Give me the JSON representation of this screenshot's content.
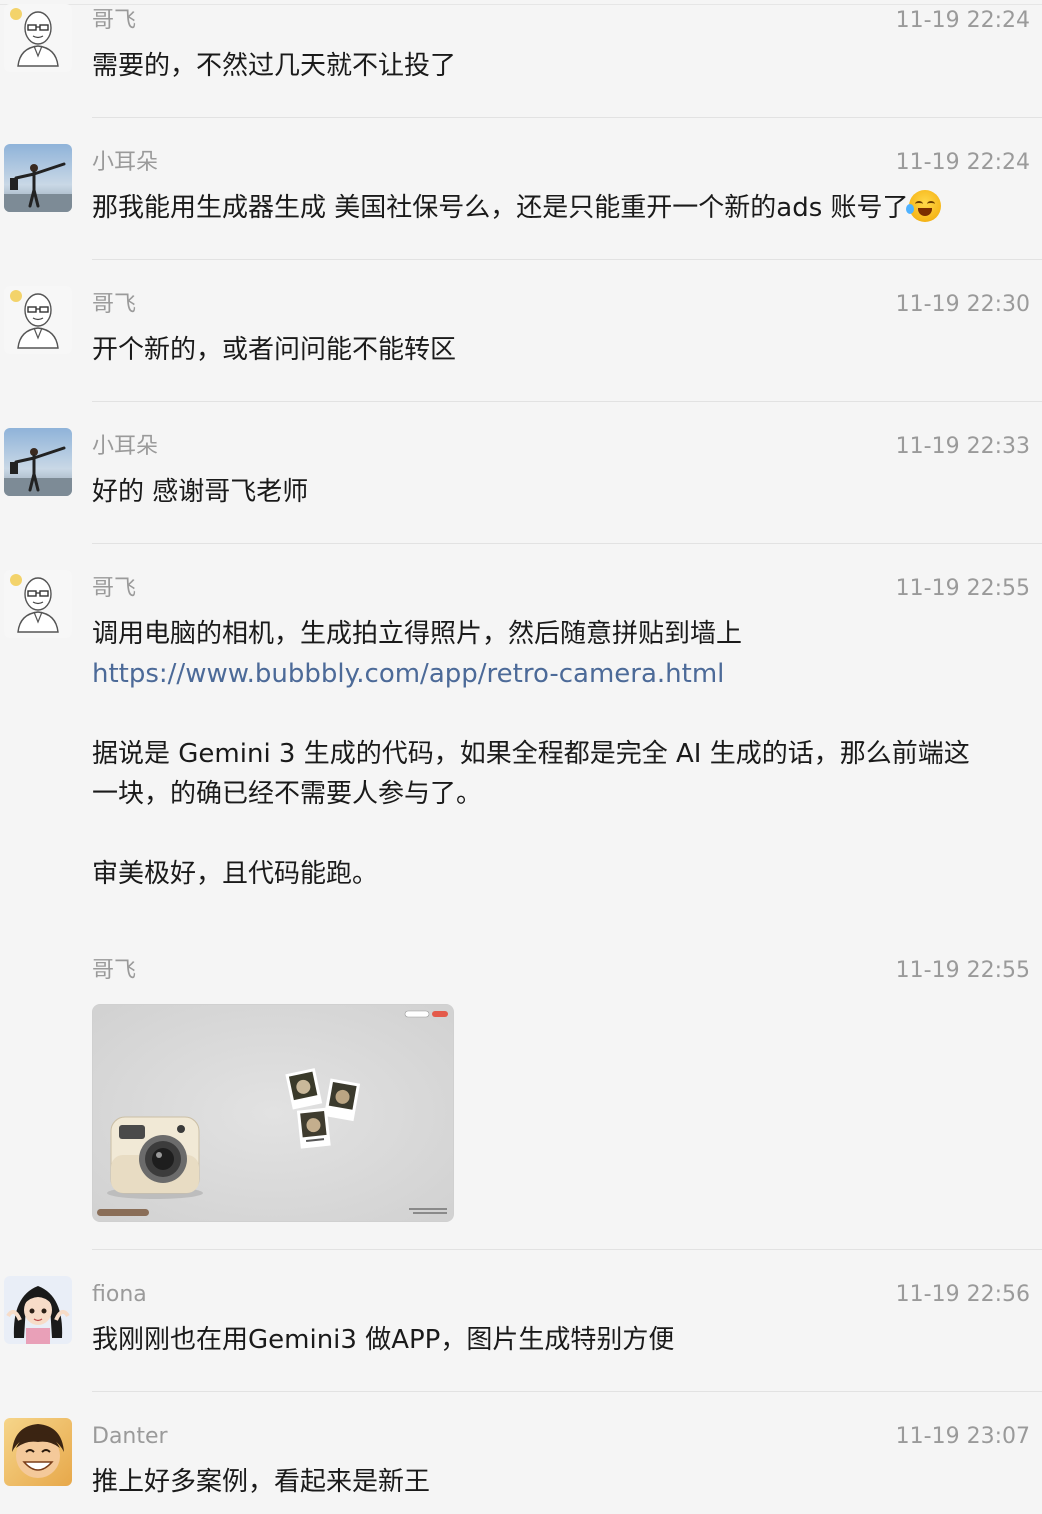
{
  "messages": [
    {
      "sender": "哥飞",
      "time": "11-19 22:24",
      "avatar": "bald-man-avatar",
      "lines": [
        "需要的，不然过几天就不让投了"
      ]
    },
    {
      "sender": "小耳朵",
      "time": "11-19 22:24",
      "avatar": "beach-person-avatar",
      "lines": [
        "那我能用生成器生成 美国社保号么，还是只能重开一个新的ads 账号了"
      ],
      "emoji": "rolling-laughing-emoji"
    },
    {
      "sender": "哥飞",
      "time": "11-19 22:30",
      "avatar": "bald-man-avatar",
      "lines": [
        "开个新的，或者问问能不能转区"
      ]
    },
    {
      "sender": "小耳朵",
      "time": "11-19 22:33",
      "avatar": "beach-person-avatar",
      "lines": [
        "好的 感谢哥飞老师"
      ]
    },
    {
      "sender": "哥飞",
      "time": "11-19 22:55",
      "avatar": "bald-man-avatar",
      "lines": [
        "调用电脑的相机，生成拍立得照片，然后随意拼贴到墙上"
      ],
      "link": "https://www.bubbbly.com/app/retro-camera.html",
      "para2": [
        "据说是 Gemini 3 生成的代码，如果全程都是完全 AI 生成的话，那么前端这",
        "一块，的确已经不需要人参与了。"
      ],
      "para3": "审美极好，且代码能跑。"
    },
    {
      "sender": "哥飞",
      "time": "11-19 22:55",
      "image": "retro-camera-app-screenshot"
    },
    {
      "sender": "fiona",
      "time": "11-19 22:56",
      "avatar": "anime-girl-avatar",
      "lines": [
        "我刚刚也在用Gemini3 做APP，图片生成特别方便"
      ]
    },
    {
      "sender": "Danter",
      "time": "11-19 23:07",
      "avatar": "smiling-boy-avatar",
      "lines": [
        "推上好多案例，看起来是新王"
      ]
    }
  ]
}
